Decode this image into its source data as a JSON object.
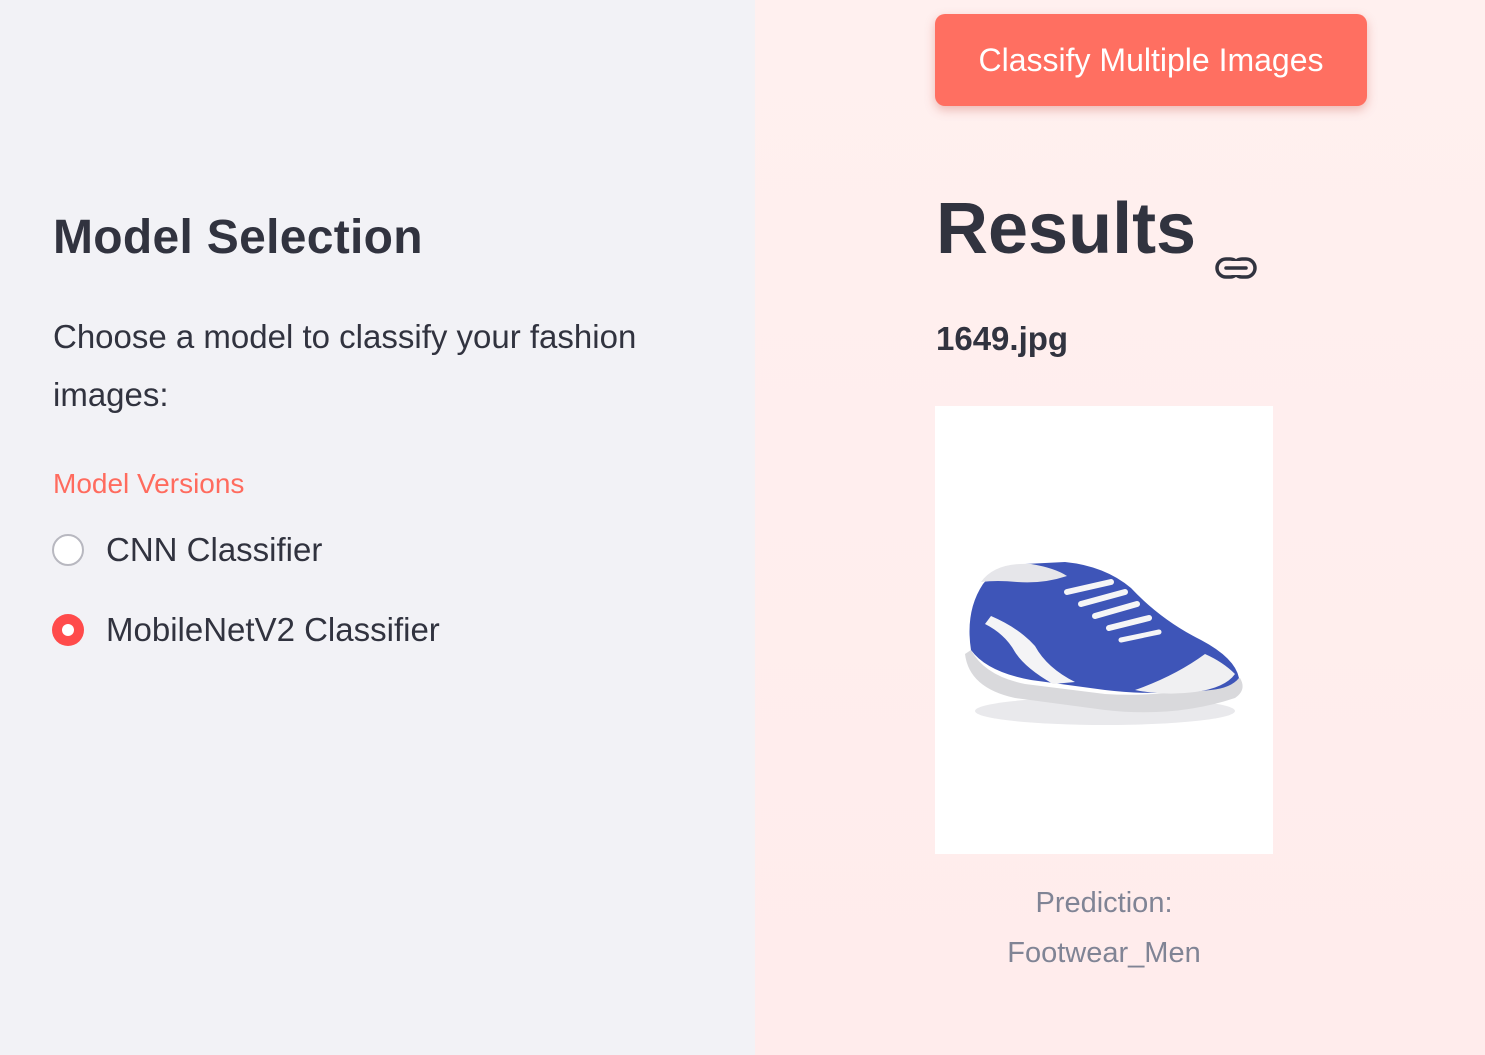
{
  "sidebar": {
    "heading": "Model Selection",
    "description": "Choose a model to classify your fashion images:",
    "radio_group": {
      "label": "Model Versions",
      "options": [
        {
          "label": "CNN Classifier",
          "selected": false
        },
        {
          "label": "MobileNetV2 Classifier",
          "selected": true
        }
      ]
    }
  },
  "main": {
    "classify_button_label": "Classify Multiple Images",
    "results_heading": "Results",
    "results_icon": "link-icon",
    "file_name": "1649.jpg",
    "image_alt": "blue sneaker",
    "caption_line1": "Prediction:",
    "caption_line2": "Footwear_Men"
  },
  "colors": {
    "sidebar_bg": "#f2f2f6",
    "main_bg": "#fff0ef",
    "accent": "#ff4b4b",
    "button_bg": "#ff6f61",
    "label_accent": "#ff6b5e",
    "text": "#31333f",
    "caption": "#808495"
  }
}
